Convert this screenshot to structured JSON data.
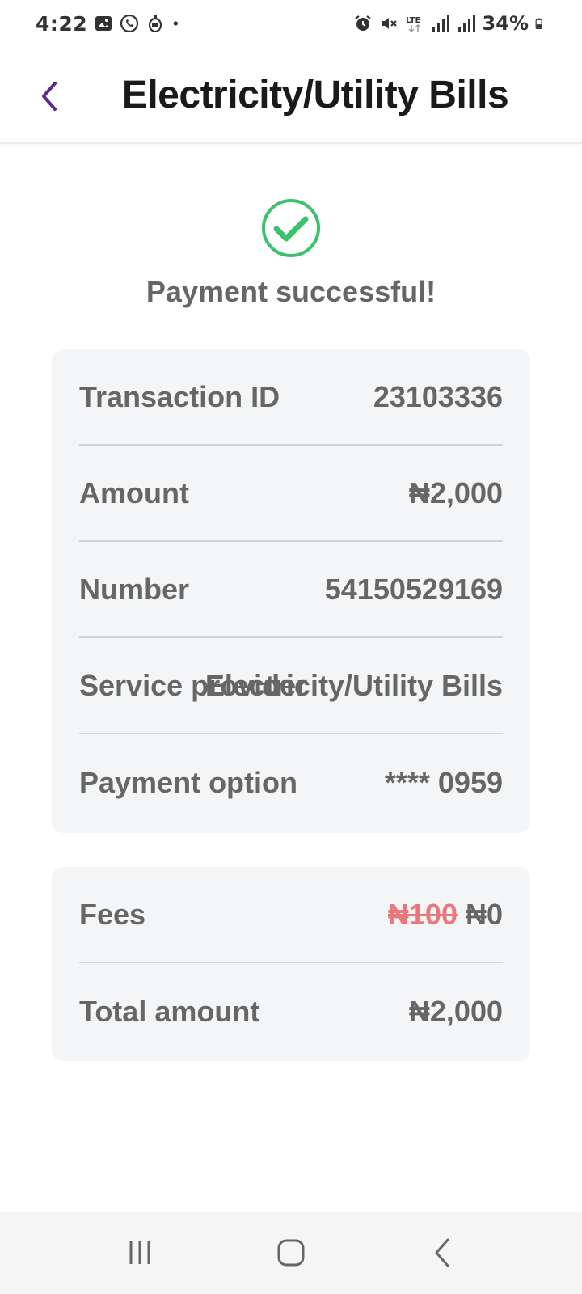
{
  "status_bar": {
    "time": "4:22",
    "battery": "34%",
    "network": "LTE"
  },
  "header": {
    "title": "Electricity/Utility Bills"
  },
  "success": {
    "message": "Payment successful!",
    "color": "#3cc16c"
  },
  "details": [
    {
      "label": "Transaction ID",
      "value": "23103336"
    },
    {
      "label": "Amount",
      "value": "₦2,000"
    },
    {
      "label": "Number",
      "value": "54150529169"
    },
    {
      "label": "Service provider",
      "value": "Electricity/Utility Bills"
    },
    {
      "label": "Payment option",
      "value": "**** 0959"
    }
  ],
  "fees": {
    "label": "Fees",
    "original_value": "₦100",
    "value": "₦0",
    "total_label": "Total amount",
    "total_value": "₦2,000"
  },
  "colors": {
    "accent": "#5b2a8f",
    "card_bg": "#f4f5f7",
    "strike": "#e8787a"
  }
}
